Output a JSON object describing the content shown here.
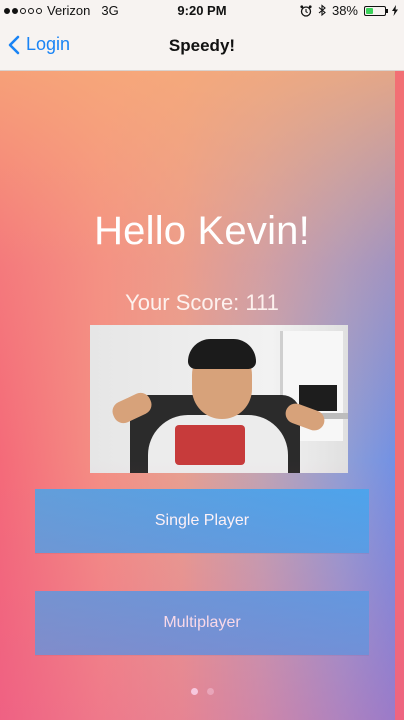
{
  "status_bar": {
    "carrier": "Verizon",
    "network": "3G",
    "time": "9:20 PM",
    "battery_percent": "38%",
    "battery_level": 0.38,
    "signal_bars_filled": 2,
    "signal_bars_total": 5,
    "icons": [
      "alarm-icon",
      "bluetooth-icon",
      "battery-icon",
      "charging-icon"
    ]
  },
  "nav": {
    "back_label": "Login",
    "title": "Speedy!"
  },
  "main": {
    "greeting": "Hello Kevin!",
    "score_text": "Your Score: 111",
    "buttons": {
      "single_player": "Single Player",
      "multiplayer": "Multiplayer"
    },
    "page_indicator": {
      "pages": 2,
      "current": 1
    }
  },
  "colors": {
    "accent": "#1a84f5",
    "button": "#4fa4e8",
    "battery": "#3bd15b"
  }
}
